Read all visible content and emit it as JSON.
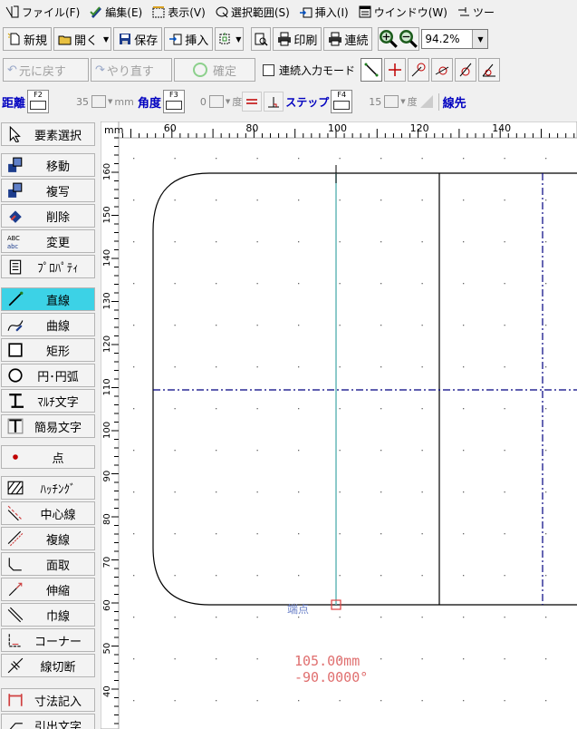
{
  "menu": {
    "items": [
      {
        "label": "ファイル(F)",
        "icon": "file-icon"
      },
      {
        "label": "編集(E)",
        "icon": "edit-icon"
      },
      {
        "label": "表示(V)",
        "icon": "view-icon"
      },
      {
        "label": "選択範囲(S)",
        "icon": "selection-icon"
      },
      {
        "label": "挿入(I)",
        "icon": "insert-icon"
      },
      {
        "label": "ウインドウ(W)",
        "icon": "window-icon"
      },
      {
        "label": "ツー",
        "icon": "tool-icon"
      }
    ]
  },
  "toolbar": {
    "new_label": "新規",
    "open_label": "開く",
    "save_label": "保存",
    "insert_label": "挿入",
    "print_label": "印刷",
    "continuous_label": "連続",
    "zoom_value": "94.2%"
  },
  "edit_bar": {
    "undo_label": "元に戻す",
    "redo_label": "やり直す",
    "confirm_label": "確定",
    "continuous_mode_label": "連続入力モード"
  },
  "param_bar": {
    "distance_label": "距離",
    "distance_key": "F2",
    "distance_value": "35",
    "distance_unit": "mm",
    "angle_label": "角度",
    "angle_key": "F3",
    "angle_value": "0",
    "angle_unit": "度",
    "step_label": "ステップ",
    "step_key": "F4",
    "step_value": "15",
    "step_unit": "度",
    "line_end_label": "線先"
  },
  "sidebar": {
    "items": [
      {
        "label": "要素選択",
        "icon": "pointer-icon"
      },
      {
        "label": "移動",
        "icon": "move-icon"
      },
      {
        "label": "複写",
        "icon": "copy-icon"
      },
      {
        "label": "削除",
        "icon": "delete-icon"
      },
      {
        "label": "変更",
        "icon": "change-icon"
      },
      {
        "label": "ﾌﾟﾛﾊﾟﾃｨ",
        "icon": "property-icon"
      },
      {
        "label": "直線",
        "icon": "line-icon",
        "active": true
      },
      {
        "label": "曲線",
        "icon": "curve-icon"
      },
      {
        "label": "矩形",
        "icon": "rectangle-icon"
      },
      {
        "label": "円･円弧",
        "icon": "circle-icon"
      },
      {
        "label": "ﾏﾙﾁ文字",
        "icon": "multi-text-icon"
      },
      {
        "label": "簡易文字",
        "icon": "simple-text-icon"
      },
      {
        "label": "点",
        "icon": "point-icon"
      },
      {
        "label": "ﾊｯﾁﾝｸﾞ",
        "icon": "hatching-icon"
      },
      {
        "label": "中心線",
        "icon": "center-line-icon"
      },
      {
        "label": "複線",
        "icon": "parallel-line-icon"
      },
      {
        "label": "面取",
        "icon": "chamfer-icon"
      },
      {
        "label": "伸縮",
        "icon": "stretch-icon"
      },
      {
        "label": "巾線",
        "icon": "width-line-icon"
      },
      {
        "label": "コーナー",
        "icon": "corner-icon"
      },
      {
        "label": "線切断",
        "icon": "line-cut-icon"
      },
      {
        "label": "寸法記入",
        "icon": "dimension-icon"
      },
      {
        "label": "引出文字",
        "icon": "leader-text-icon"
      }
    ]
  },
  "ruler": {
    "unit": "mm",
    "h_labels": [
      "60",
      "80",
      "100",
      "120",
      "140"
    ],
    "v_labels": [
      "160",
      "150",
      "140",
      "130",
      "120",
      "110",
      "100",
      "90",
      "80",
      "70",
      "60",
      "50",
      "40",
      "30"
    ]
  },
  "canvas": {
    "snap_label": "端点",
    "length_readout": "105.00mm",
    "angle_readout": "-90.0000°"
  },
  "colors": {
    "active_tool": "#3cd2e6",
    "label_blue": "#0000c0",
    "readout_red": "#e07070",
    "guide_blue": "#000080"
  }
}
